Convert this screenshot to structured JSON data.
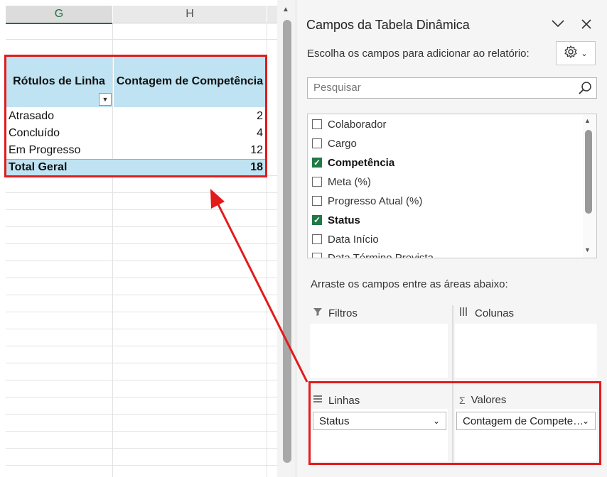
{
  "sheet": {
    "columns": [
      "G",
      "H"
    ],
    "pivot": {
      "header_row_labels": "Rótulos de Linha",
      "header_count": "Contagem de Competência",
      "rows": [
        {
          "label": "Atrasado",
          "value": "2"
        },
        {
          "label": "Concluído",
          "value": "4"
        },
        {
          "label": "Em Progresso",
          "value": "12"
        }
      ],
      "total_label": "Total Geral",
      "total_value": "18"
    }
  },
  "panel": {
    "title": "Campos da Tabela Dinâmica",
    "choose_label": "Escolha os campos para adicionar ao relatório:",
    "search_placeholder": "Pesquisar",
    "fields": [
      {
        "label": "Colaborador",
        "checked": false
      },
      {
        "label": "Cargo",
        "checked": false
      },
      {
        "label": "Competência",
        "checked": true
      },
      {
        "label": "Meta (%)",
        "checked": false
      },
      {
        "label": "Progresso Atual (%)",
        "checked": false
      },
      {
        "label": "Status",
        "checked": true
      },
      {
        "label": "Data Início",
        "checked": false
      },
      {
        "label": "Data Término Prevista",
        "checked": false
      }
    ],
    "drag_label": "Arraste os campos entre as áreas abaixo:",
    "areas": {
      "filters": "Filtros",
      "columns": "Colunas",
      "rows": "Linhas",
      "values": "Valores"
    },
    "rows_item": "Status",
    "values_item": "Contagem de Compete…"
  },
  "colors": {
    "highlight": "#e21b1b",
    "pivot_header": "#bfe3f2",
    "excel_green": "#1f7a45"
  }
}
